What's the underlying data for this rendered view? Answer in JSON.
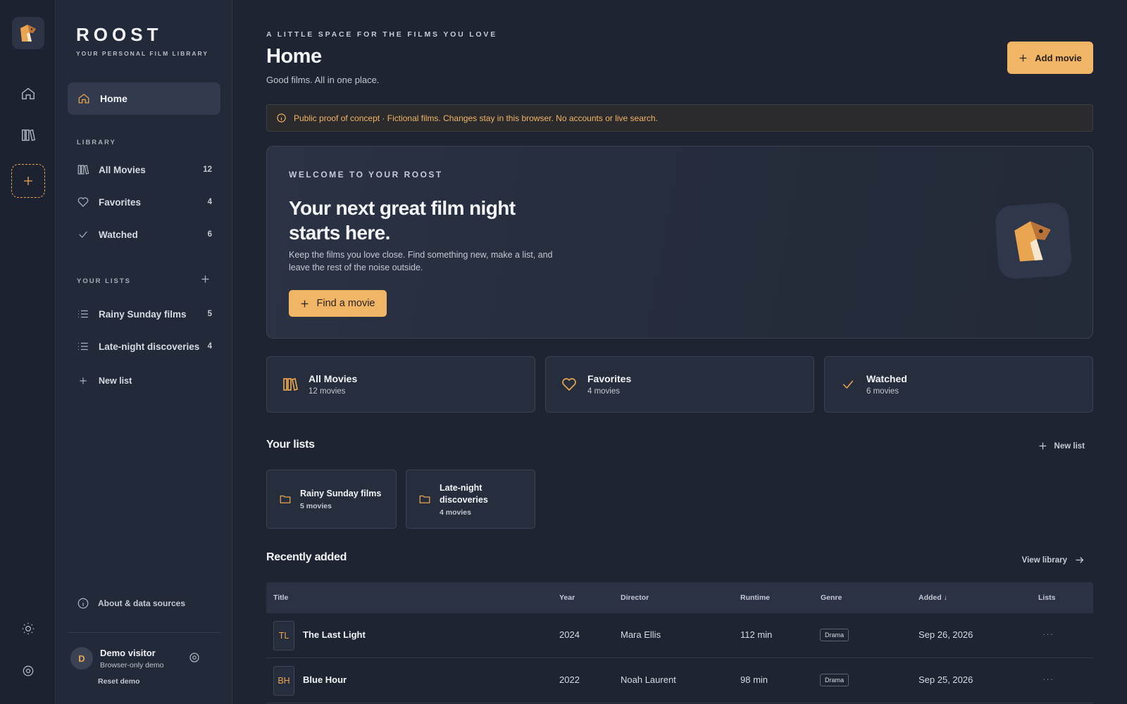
{
  "brand": {
    "title": "ROOST",
    "subtitle": "YOUR PERSONAL FILM LIBRARY"
  },
  "rail": {
    "icons": [
      "logo-icon",
      "home-icon",
      "library-icon",
      "add-icon",
      "sun-icon",
      "settings-icon"
    ]
  },
  "sidebar": {
    "home_label": "Home",
    "library_label": "LIBRARY",
    "library_items": [
      {
        "label": "All Movies",
        "count": "12",
        "icon": "library-icon"
      },
      {
        "label": "Favorites",
        "count": "4",
        "icon": "heart-icon"
      },
      {
        "label": "Watched",
        "count": "6",
        "icon": "check-icon"
      }
    ],
    "lists_label": "YOUR LISTS",
    "lists": [
      {
        "label": "Rainy Sunday films",
        "count": "5"
      },
      {
        "label": "Late-night discoveries",
        "count": "4"
      }
    ],
    "new_list_label": "New list",
    "about_label": "About & data sources",
    "user": {
      "initial": "D",
      "name": "Demo visitor",
      "subtitle": "Browser-only demo"
    },
    "reset_label": "Reset demo"
  },
  "header": {
    "eyebrow": "A LITTLE SPACE FOR THE FILMS YOU LOVE",
    "title": "Home",
    "subtitle": "Good films. All in one place.",
    "add_movie_label": "Add movie"
  },
  "notice": "Public proof of concept · Fictional films. Changes stay in this browser. No accounts or live search.",
  "hero": {
    "eyebrow": "WELCOME TO YOUR ROOST",
    "title": "Your next great film night starts here.",
    "text": "Keep the films you love close. Find something new, make a list, and leave the rest of the noise outside.",
    "button_label": "Find a movie"
  },
  "stats": [
    {
      "title": "All Movies",
      "sub": "12 movies"
    },
    {
      "title": "Favorites",
      "sub": "4 movies"
    },
    {
      "title": "Watched",
      "sub": "6 movies"
    }
  ],
  "your_lists": {
    "title": "Your lists",
    "new_list_label": "New list",
    "cards": [
      {
        "title": "Rainy Sunday films",
        "sub": "5 movies"
      },
      {
        "title": "Late-night discoveries",
        "sub": "4 movies"
      }
    ]
  },
  "recent": {
    "title": "Recently added",
    "view_label": "View library",
    "columns": [
      "Title",
      "Year",
      "Director",
      "Runtime",
      "Genre",
      "Added ↓",
      "Lists"
    ],
    "rows": [
      {
        "initials": "TL",
        "title": "The Last Light",
        "year": "2024",
        "director": "Mara Ellis",
        "runtime": "112 min",
        "genre": "Drama",
        "added": "Sep 26, 2026",
        "lists": "···"
      },
      {
        "initials": "BH",
        "title": "Blue Hour",
        "year": "2022",
        "director": "Noah Laurent",
        "runtime": "98 min",
        "genre": "Drama",
        "added": "Sep 25, 2026",
        "lists": "···"
      }
    ]
  },
  "colors": {
    "accent": "#f1b566",
    "background": "#1e2432",
    "sidebar": "#222938"
  }
}
